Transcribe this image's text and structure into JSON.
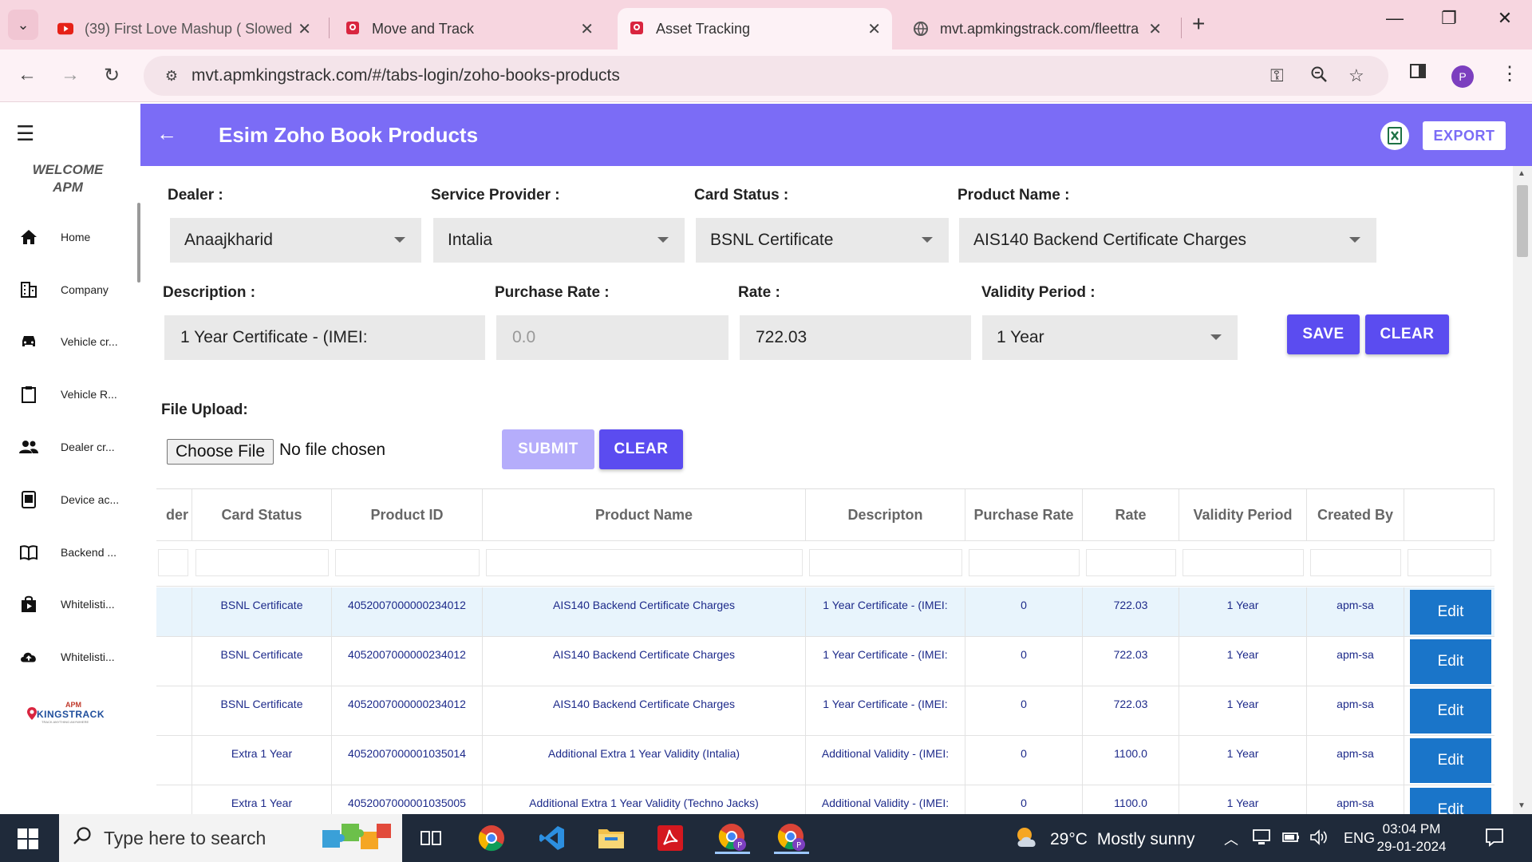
{
  "browser": {
    "tabs": [
      {
        "title": "(39) First Love Mashup ( Slowed",
        "active": false
      },
      {
        "title": "Move and Track",
        "active": false
      },
      {
        "title": "Asset Tracking",
        "active": true
      },
      {
        "title": "mvt.apmkingstrack.com/fleettra",
        "active": false
      }
    ],
    "url": "mvt.apmkingstrack.com/#/tabs-login/zoho-books-products",
    "profile_initial": "P"
  },
  "sidebar": {
    "welcome_line1": "WELCOME",
    "welcome_line2": "APM",
    "items": [
      {
        "label": "Home",
        "icon": "home-icon"
      },
      {
        "label": "Company",
        "icon": "building-icon"
      },
      {
        "label": "Vehicle cr...",
        "icon": "car-icon"
      },
      {
        "label": "Vehicle R...",
        "icon": "clipboard-icon"
      },
      {
        "label": "Dealer cr...",
        "icon": "people-icon"
      },
      {
        "label": "Device ac...",
        "icon": "device-icon"
      },
      {
        "label": "Backend ...",
        "icon": "book-icon"
      },
      {
        "label": "Whitelisti...",
        "icon": "shopping-bag-icon"
      },
      {
        "label": "Whitelisti...",
        "icon": "cloud-upload-icon"
      }
    ],
    "logo": {
      "line1": "APM",
      "line2": "KINGSTRACK",
      "line3": "TRACK ANYTHING ANYWHERE"
    }
  },
  "header": {
    "title": "Esim Zoho Book Products",
    "export_label": "EXPORT"
  },
  "form": {
    "dealer_label": "Dealer :",
    "dealer_value": "Anaajkharid",
    "service_provider_label": "Service Provider :",
    "service_provider_value": "Intalia",
    "card_status_label": "Card Status :",
    "card_status_value": "BSNL Certificate",
    "product_name_label": "Product Name :",
    "product_name_value": "AIS140 Backend Certificate Charges",
    "description_label": "Description :",
    "description_value": "1 Year Certificate - (IMEI:",
    "purchase_rate_label": "Purchase Rate :",
    "purchase_rate_placeholder": "0.0",
    "rate_label": "Rate :",
    "rate_value": "722.03",
    "validity_label": "Validity Period :",
    "validity_value": "1 Year",
    "save_label": "SAVE",
    "clear_label": "CLEAR",
    "file_upload_label": "File Upload:",
    "choose_file_label": "Choose File",
    "no_file_label": "No file chosen",
    "submit_label": "SUBMIT",
    "clear2_label": "CLEAR"
  },
  "table": {
    "headers": [
      "der",
      "Card Status",
      "Product ID",
      "Product Name",
      "Descripton",
      "Purchase Rate",
      "Rate",
      "Validity Period",
      "Created By",
      ""
    ],
    "edit_label": "Edit",
    "rows": [
      {
        "card_status": "BSNL Certificate",
        "product_id": "4052007000000234012",
        "product_name": "AIS140 Backend Certificate Charges",
        "description": "1 Year Certificate - (IMEI:",
        "purchase_rate": "0",
        "rate": "722.03",
        "validity": "1 Year",
        "created_by": "apm-sa",
        "selected": true
      },
      {
        "card_status": "BSNL Certificate",
        "product_id": "4052007000000234012",
        "product_name": "AIS140 Backend Certificate Charges",
        "description": "1 Year Certificate - (IMEI:",
        "purchase_rate": "0",
        "rate": "722.03",
        "validity": "1 Year",
        "created_by": "apm-sa",
        "selected": false
      },
      {
        "card_status": "BSNL Certificate",
        "product_id": "4052007000000234012",
        "product_name": "AIS140 Backend Certificate Charges",
        "description": "1 Year Certificate - (IMEI:",
        "purchase_rate": "0",
        "rate": "722.03",
        "validity": "1 Year",
        "created_by": "apm-sa",
        "selected": false
      },
      {
        "card_status": "Extra 1 Year",
        "product_id": "4052007000001035014",
        "product_name": "Additional Extra 1 Year Validity (Intalia)",
        "description": "Additional Validity - (IMEI:",
        "purchase_rate": "0",
        "rate": "1100.0",
        "validity": "1 Year",
        "created_by": "apm-sa",
        "selected": false
      },
      {
        "card_status": "Extra 1 Year",
        "product_id": "4052007000001035005",
        "product_name": "Additional Extra 1 Year Validity (Techno Jacks)",
        "description": "Additional Validity - (IMEI:",
        "purchase_rate": "0",
        "rate": "1100.0",
        "validity": "1 Year",
        "created_by": "apm-sa",
        "selected": false
      }
    ]
  },
  "taskbar": {
    "search_placeholder": "Type here to search",
    "weather_temp": "29°C",
    "weather_text": "Mostly sunny",
    "language": "ENG",
    "time": "03:04 PM",
    "date": "29-01-2024"
  },
  "colors": {
    "header_bg": "#7b6cf6",
    "primary_button": "#5b4cf0",
    "edit_button": "#1a75c9",
    "table_text": "#1d2a8a",
    "selected_row": "#e8f4fc",
    "tabstrip": "#f7d6e0"
  }
}
